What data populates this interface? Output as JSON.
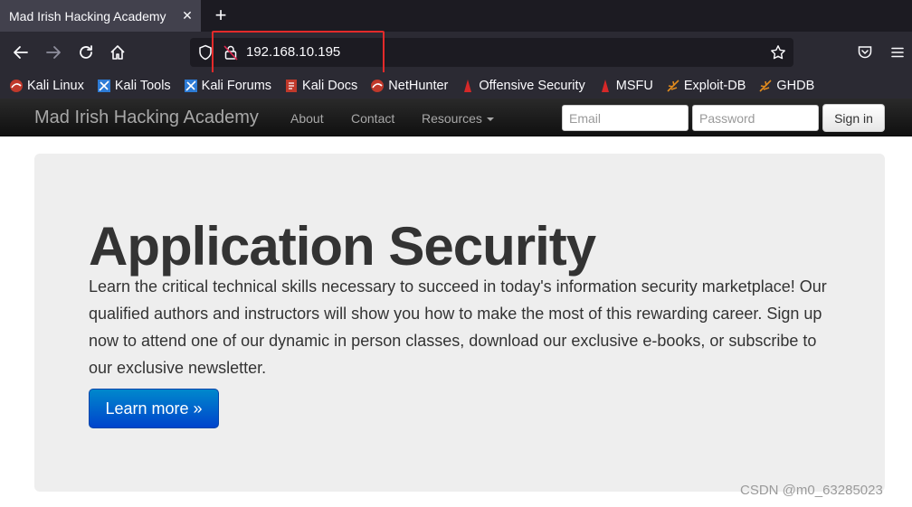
{
  "browser": {
    "tab_title": "Mad Irish Hacking Academy",
    "tab_close": "✕",
    "new_tab": "+",
    "url": "192.168.10.195"
  },
  "bookmarks": [
    {
      "label": "Kali Linux",
      "icon": "kali-icon"
    },
    {
      "label": "Kali Tools",
      "icon": "kali-tools-icon"
    },
    {
      "label": "Kali Forums",
      "icon": "kali-forums-icon"
    },
    {
      "label": "Kali Docs",
      "icon": "kali-docs-icon"
    },
    {
      "label": "NetHunter",
      "icon": "nethunter-icon"
    },
    {
      "label": "Offensive Security",
      "icon": "offsec-icon"
    },
    {
      "label": "MSFU",
      "icon": "msfu-icon"
    },
    {
      "label": "Exploit-DB",
      "icon": "exploitdb-icon"
    },
    {
      "label": "GHDB",
      "icon": "ghdb-icon"
    }
  ],
  "site": {
    "brand": "Mad Irish Hacking Academy",
    "nav": [
      "About",
      "Contact",
      "Resources"
    ],
    "email_placeholder": "Email",
    "password_placeholder": "Password",
    "signin_label": "Sign in"
  },
  "hero": {
    "heading": "Application Security",
    "body": "Learn the critical technical skills necessary to succeed in today's information security marketplace! Our qualified authors and instructors will show you how to make the most of this rewarding career. Sign up now to attend one of our dynamic in person classes, download our exclusive e-books, or subscribe to our exclusive newsletter.",
    "button_label": "Learn more »"
  },
  "watermark": "CSDN @m0_63285023",
  "colors": {
    "highlight_box": "#e32a2a",
    "button_primary": "#0066cc",
    "hero_bg": "#eeeeee"
  }
}
